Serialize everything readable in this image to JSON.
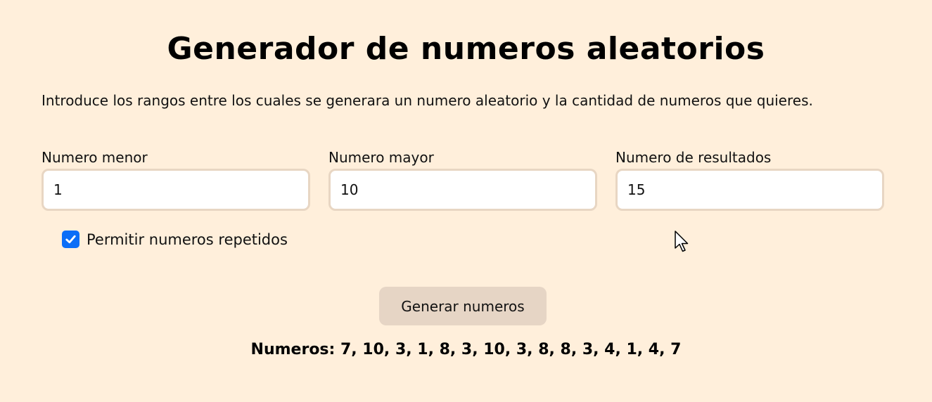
{
  "page": {
    "title": "Generador de numeros aleatorios",
    "intro": "Introduce los rangos entre los cuales se generara un numero aleatorio y la cantidad de numeros que quieres."
  },
  "form": {
    "min": {
      "label": "Numero menor",
      "value": "1"
    },
    "max": {
      "label": "Numero mayor",
      "value": "10"
    },
    "count": {
      "label": "Numero de resultados",
      "value": "15"
    },
    "allow_repeats": {
      "label": "Permitir numeros repetidos",
      "checked": true
    },
    "submit_label": "Generar numeros"
  },
  "results": {
    "text": "Numeros: 7, 10, 3, 1, 8, 3, 10, 3, 8, 8, 3, 4, 1, 4, 7"
  },
  "colors": {
    "background": "#FFEFDB",
    "input_border": "#E8D6C3",
    "button_bg": "#E6D5C5",
    "checkbox_accent": "#0B6EF7"
  },
  "icons": {
    "checkbox": "checkmark-icon",
    "pointer": "mouse-pointer-icon"
  }
}
